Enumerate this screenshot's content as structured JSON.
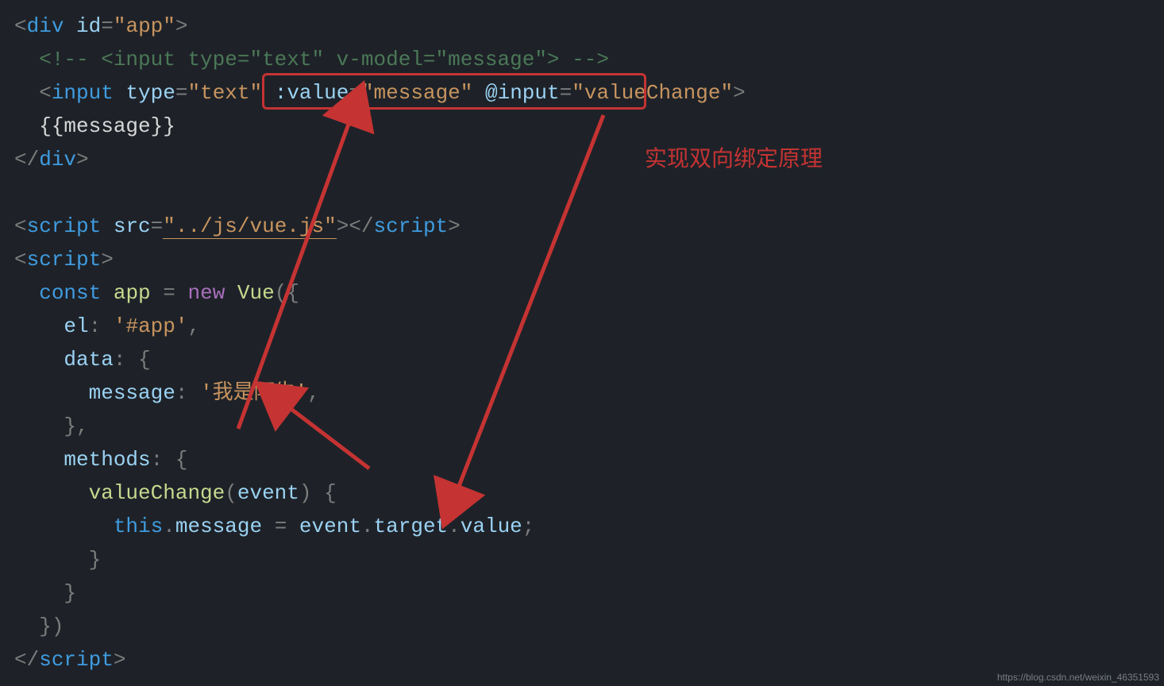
{
  "annotation_label": "实现双向绑定原理",
  "watermark": "https://blog.csdn.net/weixin_46351593",
  "highlight_box_content": ":value=\"message\" @input=\"valueChange\"",
  "code": {
    "lines": [
      {
        "n": 1,
        "tokens": [
          {
            "cls": "p",
            "t": "<"
          },
          {
            "cls": "tag",
            "t": "div"
          },
          {
            "cls": "txt",
            "t": " "
          },
          {
            "cls": "attr",
            "t": "id"
          },
          {
            "cls": "p",
            "t": "="
          },
          {
            "cls": "str",
            "t": "\"app\""
          },
          {
            "cls": "p",
            "t": ">"
          }
        ]
      },
      {
        "n": 2,
        "indent": 1,
        "tokens": [
          {
            "cls": "cmt",
            "t": "<!-- <input type=\"text\" v-model=\"message\"> -->"
          }
        ]
      },
      {
        "n": 3,
        "indent": 1,
        "tokens": [
          {
            "cls": "p",
            "t": "<"
          },
          {
            "cls": "tag",
            "t": "input"
          },
          {
            "cls": "txt",
            "t": " "
          },
          {
            "cls": "attr",
            "t": "type"
          },
          {
            "cls": "p",
            "t": "="
          },
          {
            "cls": "str",
            "t": "\"text\""
          },
          {
            "cls": "txt",
            "t": " "
          },
          {
            "cls": "attr",
            "t": ":value"
          },
          {
            "cls": "p",
            "t": "="
          },
          {
            "cls": "str",
            "t": "\"message\""
          },
          {
            "cls": "txt",
            "t": " "
          },
          {
            "cls": "attr",
            "t": "@input"
          },
          {
            "cls": "p",
            "t": "="
          },
          {
            "cls": "str",
            "t": "\"valueChange\""
          },
          {
            "cls": "p",
            "t": ">"
          }
        ]
      },
      {
        "n": 4,
        "indent": 1,
        "tokens": [
          {
            "cls": "txt",
            "t": "{{message}}"
          }
        ]
      },
      {
        "n": 5,
        "tokens": [
          {
            "cls": "p",
            "t": "</"
          },
          {
            "cls": "tag",
            "t": "div"
          },
          {
            "cls": "p",
            "t": ">"
          }
        ]
      },
      {
        "n": 6,
        "tokens": []
      },
      {
        "n": 7,
        "tokens": [
          {
            "cls": "p",
            "t": "<"
          },
          {
            "cls": "tag",
            "t": "script"
          },
          {
            "cls": "txt",
            "t": " "
          },
          {
            "cls": "attr",
            "t": "src"
          },
          {
            "cls": "p",
            "t": "="
          },
          {
            "cls": "str und",
            "t": "\"../js/vue.js\""
          },
          {
            "cls": "p",
            "t": ">"
          },
          {
            "cls": "p",
            "t": "</"
          },
          {
            "cls": "tag",
            "t": "script"
          },
          {
            "cls": "p",
            "t": ">"
          }
        ]
      },
      {
        "n": 8,
        "tokens": [
          {
            "cls": "p",
            "t": "<"
          },
          {
            "cls": "tag",
            "t": "script"
          },
          {
            "cls": "p",
            "t": ">"
          }
        ]
      },
      {
        "n": 9,
        "indent": 1,
        "tokens": [
          {
            "cls": "kw",
            "t": "const"
          },
          {
            "cls": "txt",
            "t": " "
          },
          {
            "cls": "id",
            "t": "app"
          },
          {
            "cls": "txt",
            "t": " "
          },
          {
            "cls": "p",
            "t": "="
          },
          {
            "cls": "txt",
            "t": " "
          },
          {
            "cls": "kw2",
            "t": "new"
          },
          {
            "cls": "txt",
            "t": " "
          },
          {
            "cls": "id",
            "t": "Vue"
          },
          {
            "cls": "p",
            "t": "({"
          }
        ]
      },
      {
        "n": 10,
        "indent": 2,
        "tokens": [
          {
            "cls": "prop",
            "t": "el"
          },
          {
            "cls": "p",
            "t": ":"
          },
          {
            "cls": "txt",
            "t": " "
          },
          {
            "cls": "str",
            "t": "'#app'"
          },
          {
            "cls": "p",
            "t": ","
          }
        ]
      },
      {
        "n": 11,
        "indent": 2,
        "tokens": [
          {
            "cls": "prop",
            "t": "data"
          },
          {
            "cls": "p",
            "t": ":"
          },
          {
            "cls": "txt",
            "t": " "
          },
          {
            "cls": "p",
            "t": "{"
          }
        ]
      },
      {
        "n": 12,
        "indent": 3,
        "tokens": [
          {
            "cls": "prop",
            "t": "message"
          },
          {
            "cls": "p",
            "t": ":"
          },
          {
            "cls": "txt",
            "t": " "
          },
          {
            "cls": "str",
            "t": "'我是阿牛'"
          },
          {
            "cls": "p",
            "t": ","
          }
        ]
      },
      {
        "n": 13,
        "indent": 2,
        "tokens": [
          {
            "cls": "p",
            "t": "},"
          }
        ]
      },
      {
        "n": 14,
        "indent": 2,
        "tokens": [
          {
            "cls": "prop",
            "t": "methods"
          },
          {
            "cls": "p",
            "t": ":"
          },
          {
            "cls": "txt",
            "t": " "
          },
          {
            "cls": "p",
            "t": "{"
          }
        ]
      },
      {
        "n": 15,
        "indent": 3,
        "tokens": [
          {
            "cls": "id",
            "t": "valueChange"
          },
          {
            "cls": "p",
            "t": "("
          },
          {
            "cls": "prop",
            "t": "event"
          },
          {
            "cls": "p",
            "t": ")"
          },
          {
            "cls": "txt",
            "t": " "
          },
          {
            "cls": "p",
            "t": "{"
          }
        ]
      },
      {
        "n": 16,
        "indent": 4,
        "tokens": [
          {
            "cls": "th",
            "t": "this"
          },
          {
            "cls": "p",
            "t": "."
          },
          {
            "cls": "prop",
            "t": "message"
          },
          {
            "cls": "txt",
            "t": " "
          },
          {
            "cls": "p",
            "t": "="
          },
          {
            "cls": "txt",
            "t": " "
          },
          {
            "cls": "prop",
            "t": "event"
          },
          {
            "cls": "p",
            "t": "."
          },
          {
            "cls": "prop",
            "t": "target"
          },
          {
            "cls": "p",
            "t": "."
          },
          {
            "cls": "prop",
            "t": "value"
          },
          {
            "cls": "p",
            "t": ";"
          }
        ]
      },
      {
        "n": 17,
        "indent": 3,
        "tokens": [
          {
            "cls": "p",
            "t": "}"
          }
        ]
      },
      {
        "n": 18,
        "indent": 2,
        "tokens": [
          {
            "cls": "p",
            "t": "}"
          }
        ]
      },
      {
        "n": 19,
        "indent": 1,
        "tokens": [
          {
            "cls": "p",
            "t": "})"
          }
        ]
      },
      {
        "n": 20,
        "tokens": [
          {
            "cls": "p",
            "t": "</"
          },
          {
            "cls": "tag",
            "t": "script"
          },
          {
            "cls": "p",
            "t": ">"
          }
        ]
      }
    ]
  }
}
